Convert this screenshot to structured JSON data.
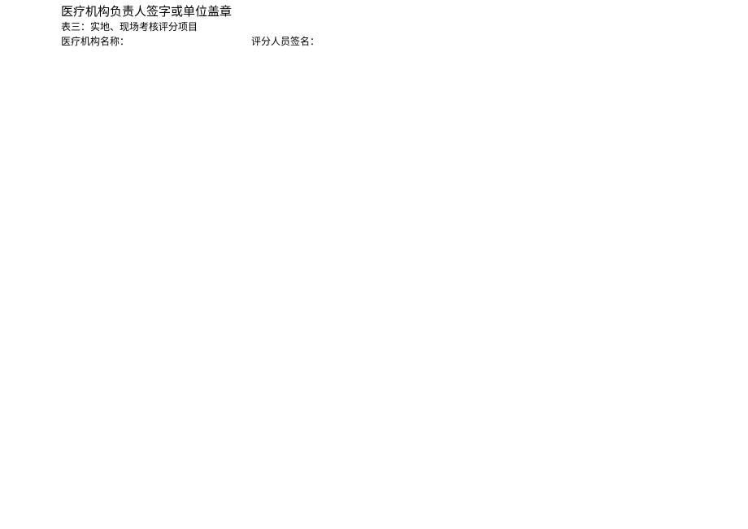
{
  "document": {
    "heading": "医疗机构负责人签字或单位盖章",
    "table_title": "表三：实地、现场考核评分项目",
    "field1_label": "医疗机构名称：",
    "field2_label": "评分人员签名："
  }
}
